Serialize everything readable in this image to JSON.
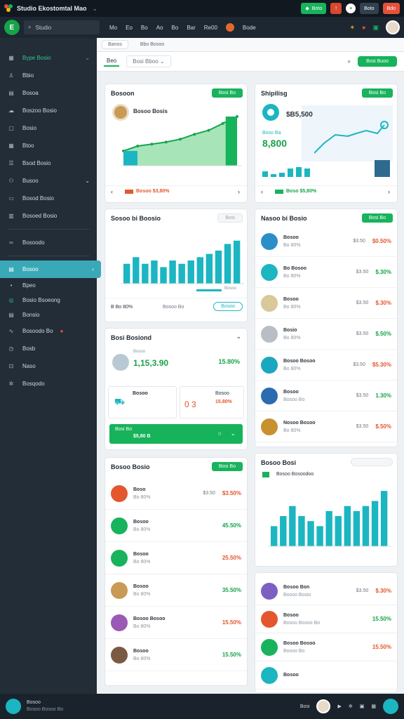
{
  "app": {
    "title": "Studio Ekostomtal Mao",
    "tb_btn1": "Boto",
    "tb_btn2": "Boto",
    "tb_btn3": "Bdo"
  },
  "nav": {
    "brand": "Ε",
    "search_placeholder": "Studio",
    "items": [
      "Mo",
      "Eo",
      "Bo",
      "Ao",
      "Bo",
      "Bar",
      "Re00",
      "Bode"
    ]
  },
  "sidebar": {
    "items": [
      {
        "label": "Bype Bosio",
        "icon": "grid-icon"
      },
      {
        "label": "Bbio",
        "icon": "user-icon"
      },
      {
        "label": "Bosoa",
        "icon": "doc-icon"
      },
      {
        "label": "Boszoo Bosio",
        "icon": "cloud-icon"
      },
      {
        "label": "Bosio",
        "icon": "box-icon"
      },
      {
        "label": "Btoo",
        "icon": "calendar-icon"
      },
      {
        "label": "Bsod Bosio",
        "icon": "list-icon"
      },
      {
        "label": "Busoo",
        "icon": "network-icon"
      },
      {
        "label": "Bosod Bosio",
        "icon": "card-icon"
      },
      {
        "label": "Bosoed Bosio",
        "icon": "folder-icon"
      },
      {
        "label": "Bosoodo",
        "icon": "link-icon"
      },
      {
        "label": "Bosoo",
        "icon": "chart-icon",
        "active": true
      },
      {
        "label": "Bpeo",
        "icon": "dot-icon"
      },
      {
        "label": "Bosio Bsoeong",
        "icon": "circle-icon"
      },
      {
        "label": "Bonsio",
        "icon": "doc-icon"
      },
      {
        "label": "Bosoodo Bo",
        "icon": "pulse-icon"
      },
      {
        "label": "Bosb",
        "icon": "clock-icon"
      },
      {
        "label": "Naso",
        "icon": "lock-icon"
      },
      {
        "label": "Bosqodo",
        "icon": "settings-icon"
      }
    ]
  },
  "tabs": [
    "Banos",
    "Bbo Bosoo"
  ],
  "toolbar": {
    "tab_main": "Beo",
    "dropdown": "Bosi Bboo",
    "button": "Bosi Buoo"
  },
  "card_revenue": {
    "title": "Bosoon",
    "button": "Bosi Bo",
    "subtitle": "Bosoo Bosis",
    "footer": "Bosoo $3,80%"
  },
  "card_shipping": {
    "title": "Shipilisg",
    "button": "Bosi Bo",
    "amount1": "$B5,500",
    "amount2": "8,800",
    "label": "Boso Ba",
    "footer": "Boso $5,80%"
  },
  "card_sales": {
    "title": "Sosoo bi Boosio",
    "button": "Bosi",
    "legend": "Bosoo",
    "footer_a": "B Bo 80%",
    "footer_b": "Bosoo Bo",
    "outline_btn": "Bosoo"
  },
  "card_summary": {
    "title": "Bosi Bosiond",
    "amount": "1,15,3.90",
    "pct": "15.80%",
    "sub": "Bosoo",
    "mini1": "Bosoo",
    "mini2": "Bosoo",
    "mini_val": "0 3",
    "mini_pct": "15.80%",
    "green_label": "Bosi Bo",
    "green_sub": "$5,80 B"
  },
  "card_markets": {
    "title": "Nasoo bi Bosio",
    "button": "Bosi Bo",
    "rows": [
      {
        "name": "Bosoo",
        "sub": "Bo 80%",
        "v1": "$3.50",
        "v2": "$0.50%",
        "icon": "doc-icon"
      },
      {
        "name": "Bo Bosoo",
        "sub": "Bo 80%",
        "v1": "$3.50",
        "v2": "$.30%",
        "icon": "loop-icon"
      },
      {
        "name": "Bosoo",
        "sub": "Bo 80%",
        "v1": "$3.50",
        "v2": "$.30%",
        "icon": "coin-icon"
      },
      {
        "name": "Bosio",
        "sub": "Bo 80%",
        "v1": "$3.50",
        "v2": "$.50%",
        "icon": "coin-icon"
      },
      {
        "name": "Bosoo Bosoo",
        "sub": "Bo 80%",
        "v1": "$3.50",
        "v2": "$5.30%",
        "icon": "basket-icon"
      },
      {
        "name": "Bosoo",
        "sub": "Bosoo Bo",
        "v1": "$3.50",
        "v2": "1.30%",
        "icon": "doc-icon"
      },
      {
        "name": "Nosoo Bosoo",
        "sub": "Bo 80%",
        "v1": "$3.50",
        "v2": "$.50%",
        "icon": "gear-icon"
      }
    ]
  },
  "card_trends": {
    "title": "Bosoo Bosio",
    "button": "Bosi Bo",
    "rows": [
      {
        "name": "Boso",
        "sub": "Bo 80%",
        "v1": "$3.50",
        "v2": "$3.50%",
        "icon": "pizza-icon"
      },
      {
        "name": "Bosoo",
        "sub": "Bo 80%",
        "v1": "",
        "v2": "45.50%",
        "icon": "leaf-icon"
      },
      {
        "name": "Bosoo",
        "sub": "Bo 80%",
        "v1": "",
        "v2": "25.50%",
        "icon": "leaf-icon"
      },
      {
        "name": "Bosoo",
        "sub": "Bo 80%",
        "v1": "",
        "v2": "35.50%",
        "icon": "food-icon"
      },
      {
        "name": "Bosoo Bosoo",
        "sub": "Bo 80%",
        "v1": "",
        "v2": "15.50%",
        "icon": "flower-icon"
      },
      {
        "name": "Bosoo",
        "sub": "Bo 80%",
        "v1": "",
        "v2": "15.50%",
        "icon": "food-icon"
      }
    ]
  },
  "card_bars2": {
    "title": "Bosoo Bosi",
    "label": "Bosoo Bosoodoo"
  },
  "card_products": {
    "rows": [
      {
        "name": "Bosoo Bon",
        "sub": "Bosoo Bosio",
        "v1": "$3.50",
        "v2": "$.30%",
        "icon": "cube-icon"
      },
      {
        "name": "Bosoo",
        "sub": "Bosoo Bosoo Bo",
        "v1": "",
        "v2": "15.50%",
        "icon": "pie-icon"
      },
      {
        "name": "Bosoo Bosoo",
        "sub": "Bosoo Bo",
        "v1": "",
        "v2": "15.50%",
        "icon": "check-icon"
      },
      {
        "name": "Bosoo",
        "sub": "",
        "v1": "",
        "v2": "",
        "icon": "dot-icon"
      }
    ]
  },
  "bottom": {
    "line1": "Bosoo",
    "line2": "Bosoo Bosoo Bo",
    "right": "Bosi"
  },
  "chart_data": [
    {
      "type": "area",
      "title": "Bosoon",
      "values": [
        3,
        4,
        4.4,
        4.8,
        5.4,
        6.4,
        7.2,
        8.6,
        10
      ],
      "ylim": [
        0,
        10
      ]
    },
    {
      "type": "bar",
      "title": "Sosoo bi Boosio",
      "values": [
        6,
        8,
        6,
        7,
        5,
        7,
        6,
        7,
        8,
        9,
        10,
        12,
        13
      ],
      "ylim": [
        0,
        14
      ]
    },
    {
      "type": "bar",
      "title": "Bosoo Bosi",
      "values": [
        4,
        6,
        8,
        6,
        5,
        4,
        7,
        6,
        8,
        7,
        8,
        9,
        11
      ],
      "ylim": [
        0,
        12
      ]
    }
  ],
  "colors": {
    "accent": "#16b35a",
    "teal": "#1bb6c1",
    "sidebar": "#222d38",
    "topbar": "#111820"
  }
}
